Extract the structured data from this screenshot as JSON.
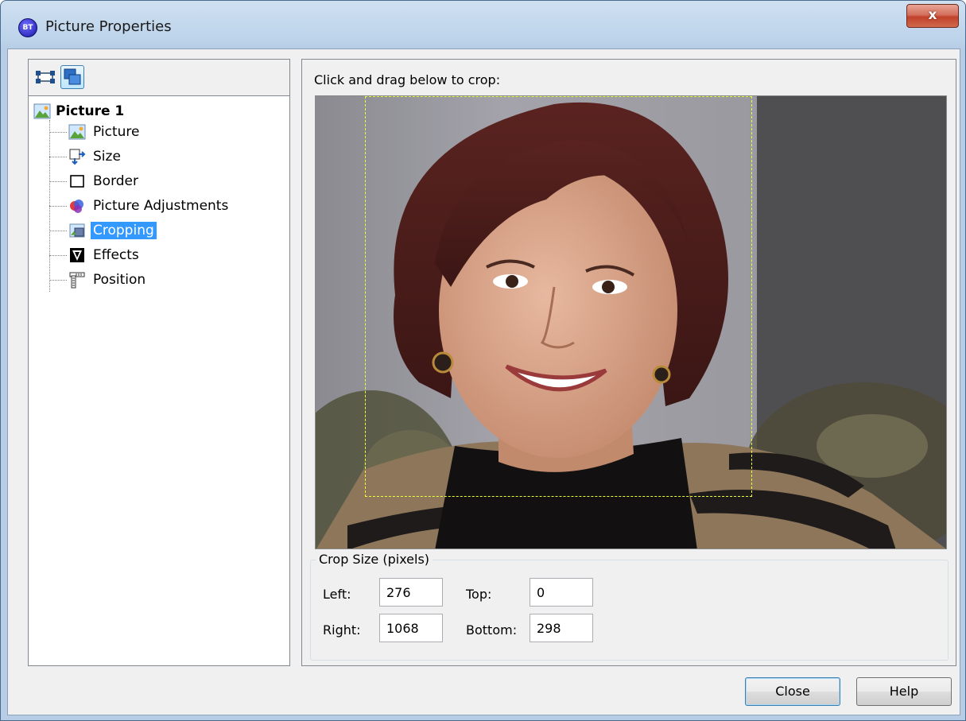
{
  "window": {
    "title": "Picture Properties",
    "close_glyph": "x"
  },
  "tree": {
    "root": "Picture 1",
    "items": [
      {
        "label": "Picture",
        "icon": "picture-icon"
      },
      {
        "label": "Size",
        "icon": "size-icon"
      },
      {
        "label": "Border",
        "icon": "border-icon"
      },
      {
        "label": "Picture Adjustments",
        "icon": "adjustments-icon"
      },
      {
        "label": "Cropping",
        "icon": "cropping-icon",
        "selected": true
      },
      {
        "label": "Effects",
        "icon": "effects-icon"
      },
      {
        "label": "Position",
        "icon": "position-icon"
      }
    ]
  },
  "crop": {
    "hint": "Click and drag below to crop:",
    "group_title": "Crop Size (pixels)",
    "left_label": "Left:",
    "left_value": "276",
    "top_label": "Top:",
    "top_value": "0",
    "right_label": "Right:",
    "right_value": "1068",
    "bottom_label": "Bottom:",
    "bottom_value": "298"
  },
  "buttons": {
    "close": "Close",
    "help": "Help"
  },
  "colors": {
    "selection": "#3399ff",
    "crop_marquee": "#e8ff3c"
  }
}
